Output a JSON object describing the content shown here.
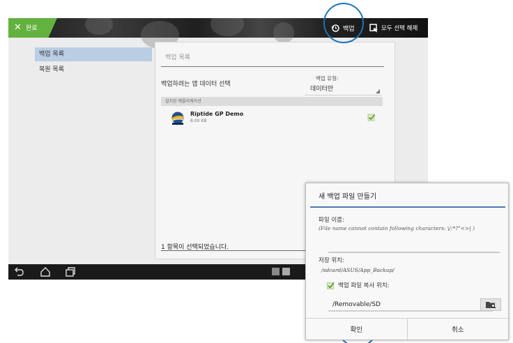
{
  "topbar": {
    "done_label": "완료",
    "backup_label": "백업",
    "deselect_all_label": "모두 선택 해제"
  },
  "sidebar": {
    "items": [
      {
        "label": "백업 목록",
        "selected": true
      },
      {
        "label": "복원 목록",
        "selected": false
      }
    ]
  },
  "panel": {
    "title": "백업 목록",
    "select_label": "백업하려는 앱 데이터 선택",
    "backup_type_label": "백업 유형:",
    "backup_type_value": "데이터만",
    "section_header": "설치된 애플리케이션",
    "apps": [
      {
        "name": "Riptide GP Demo",
        "size": "8.00 KB",
        "checked": true
      }
    ],
    "status": "1 항목이 선택되었습니다."
  },
  "dialog": {
    "title": "새 백업 파일 만들기",
    "file_name_label": "파일 이름:",
    "file_name_hint": "(File name cannot contain following characters: \\/:*?\"<>| )",
    "file_name_value": "",
    "location_label": "저장 위치:",
    "location_value": "/sdcard/ASUS/App_Backup/",
    "copy_label": "백업 파일 복사 위치:",
    "copy_checked": true,
    "copy_path": "/Removable/SD",
    "ok_label": "확인",
    "cancel_label": "취소"
  },
  "colors": {
    "accent_green": "#62b23d",
    "highlight_blue": "#1a73b8",
    "selected_nav": "#b9cde3",
    "dialog_rule": "#4a7ab8"
  },
  "icons": {
    "close": "close-icon",
    "backup": "backup-clock-icon",
    "deselect": "deselect-cursor-icon",
    "back": "back-icon",
    "home": "home-icon",
    "recents": "recent-apps-icon",
    "folder": "folder-browse-icon"
  }
}
